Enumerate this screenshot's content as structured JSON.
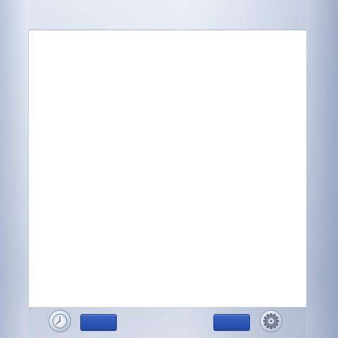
{
  "window": {
    "content": ""
  },
  "bottom_bar": {
    "left_round_button_icon": "clock-icon",
    "right_round_button_icon": "gear-icon",
    "left_button_label": "",
    "right_button_label": "",
    "button_color": "#2c55b4"
  }
}
